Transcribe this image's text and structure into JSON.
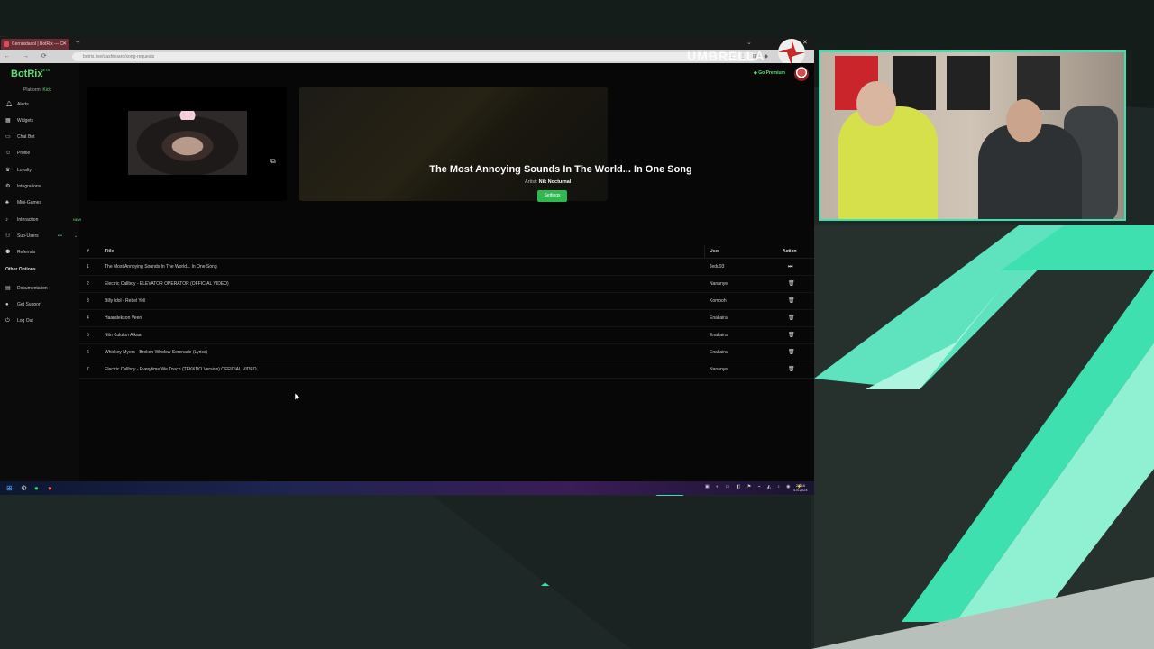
{
  "browser": {
    "tab_title": "Cerrasdacol | BotRix — C",
    "url": "botrix.live/dashboard/song-requests",
    "overlay_text": "UMBRELLA"
  },
  "app": {
    "logo": "BotRix",
    "beta": "BETA",
    "platform_label": "Platform:",
    "platform_value": "Kick",
    "go_premium": "Go Premium",
    "nav": [
      {
        "label": "Alerts",
        "icon": "bell-icon"
      },
      {
        "label": "Widgets",
        "icon": "widgets-icon"
      },
      {
        "label": "Chat Bot",
        "icon": "chat-icon"
      },
      {
        "label": "Profile",
        "icon": "profile-icon"
      },
      {
        "label": "Loyalty",
        "icon": "loyalty-icon"
      },
      {
        "label": "Integrations",
        "icon": "integrations-icon"
      },
      {
        "label": "Mini-Games",
        "icon": "games-icon"
      },
      {
        "label": "Interaction",
        "icon": "music-icon",
        "badge": "NEW"
      },
      {
        "label": "Sub-Users",
        "icon": "users-icon"
      },
      {
        "label": "Referrals",
        "icon": "referrals-icon"
      }
    ],
    "other_options_label": "Other Options",
    "other_nav": [
      {
        "label": "Documentation",
        "icon": "doc-icon"
      },
      {
        "label": "Get Support",
        "icon": "support-icon"
      },
      {
        "label": "Log Out",
        "icon": "logout-icon"
      }
    ],
    "now_playing": {
      "title": "The Most Annoying Sounds In The World... In One Song",
      "artist_label": "Artist:",
      "artist": "Nik Nocturnal",
      "settings_button": "Settings"
    },
    "queue": {
      "headers": {
        "num": "#",
        "title": "Title",
        "user": "User",
        "action": "Action"
      },
      "rows": [
        {
          "num": "1",
          "title": "The Most Annoying Sounds In The World... In One Song",
          "user": "Jedu93",
          "action": "skip"
        },
        {
          "num": "2",
          "title": "Electric Callboy - ELEVATOR OPERATOR (OFFICIAL VIDEO)",
          "user": "Nananye",
          "action": "delete"
        },
        {
          "num": "3",
          "title": "Billy Idol - Rebel Yell",
          "user": "Komooh",
          "action": "delete"
        },
        {
          "num": "4",
          "title": "Haaratekson Veen",
          "user": "Enakaira",
          "action": "delete"
        },
        {
          "num": "5",
          "title": "Niin Kuluton Alkaa",
          "user": "Enakaira",
          "action": "delete"
        },
        {
          "num": "6",
          "title": "Whiskey Myers - Broken Window Serenade (Lyrics)",
          "user": "Enakaira",
          "action": "delete"
        },
        {
          "num": "7",
          "title": "Electric Callboy - Everytime We Touch (TEKKNO Version) OFFICIAL VIDEO",
          "user": "Nananye",
          "action": "delete"
        }
      ]
    }
  },
  "taskbar": {
    "clock_time": "22:48",
    "clock_date": "4.8.2024"
  },
  "colors": {
    "accent_green": "#2eb84f",
    "cam_border": "#3ee0b0",
    "bg_teal": "#3ee0b0"
  }
}
